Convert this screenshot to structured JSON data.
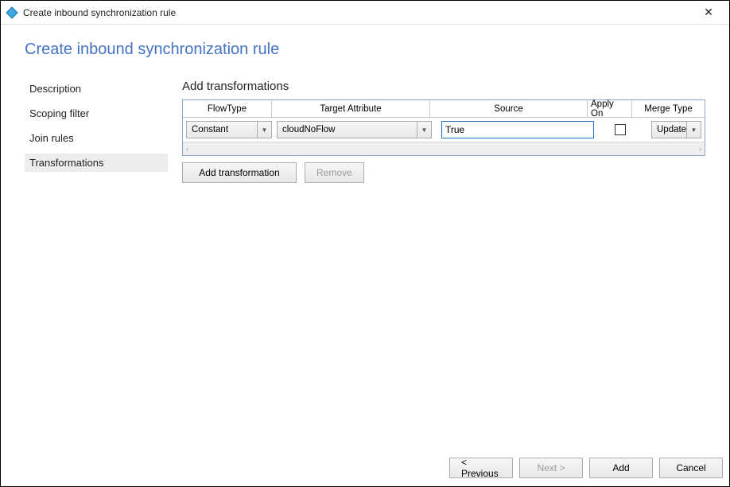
{
  "titlebar": {
    "title": "Create inbound synchronization rule"
  },
  "page": {
    "title": "Create inbound synchronization rule"
  },
  "sidebar": {
    "items": [
      {
        "label": "Description"
      },
      {
        "label": "Scoping filter"
      },
      {
        "label": "Join rules"
      },
      {
        "label": "Transformations"
      }
    ],
    "selected_index": 3
  },
  "main": {
    "section_title": "Add transformations",
    "columns": {
      "flow": "FlowType",
      "target": "Target Attribute",
      "source": "Source",
      "apply": "Apply On",
      "merge": "Merge Type"
    },
    "row": {
      "flow_value": "Constant",
      "target_value": "cloudNoFlow",
      "source_value": "True",
      "apply_checked": false,
      "merge_value": "Update"
    },
    "buttons": {
      "add_transformation": "Add transformation",
      "remove": "Remove"
    }
  },
  "footer": {
    "previous": "< Previous",
    "next": "Next >",
    "add": "Add",
    "cancel": "Cancel"
  }
}
